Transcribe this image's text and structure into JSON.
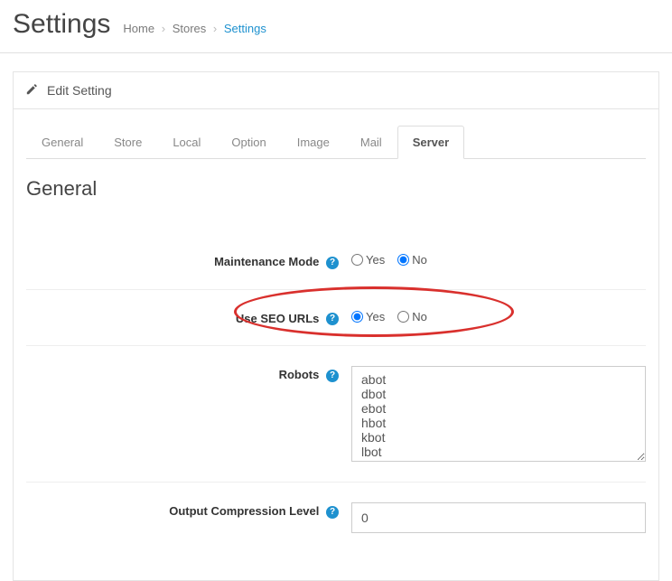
{
  "header": {
    "title": "Settings",
    "breadcrumb": {
      "home": "Home",
      "stores": "Stores",
      "settings": "Settings"
    }
  },
  "panel": {
    "heading": "Edit Setting"
  },
  "tabs": [
    {
      "label": "General"
    },
    {
      "label": "Store"
    },
    {
      "label": "Local"
    },
    {
      "label": "Option"
    },
    {
      "label": "Image"
    },
    {
      "label": "Mail"
    },
    {
      "label": "Server"
    }
  ],
  "section_title": "General",
  "fields": {
    "maintenance": {
      "label": "Maintenance Mode",
      "yes": "Yes",
      "no": "No",
      "value": "no"
    },
    "seo": {
      "label": "Use SEO URLs",
      "yes": "Yes",
      "no": "No",
      "value": "yes"
    },
    "robots": {
      "label": "Robots",
      "value": "abot\ndbot\nebot\nhbot\nkbot\nlbot"
    },
    "compression": {
      "label": "Output Compression Level",
      "value": "0"
    }
  }
}
